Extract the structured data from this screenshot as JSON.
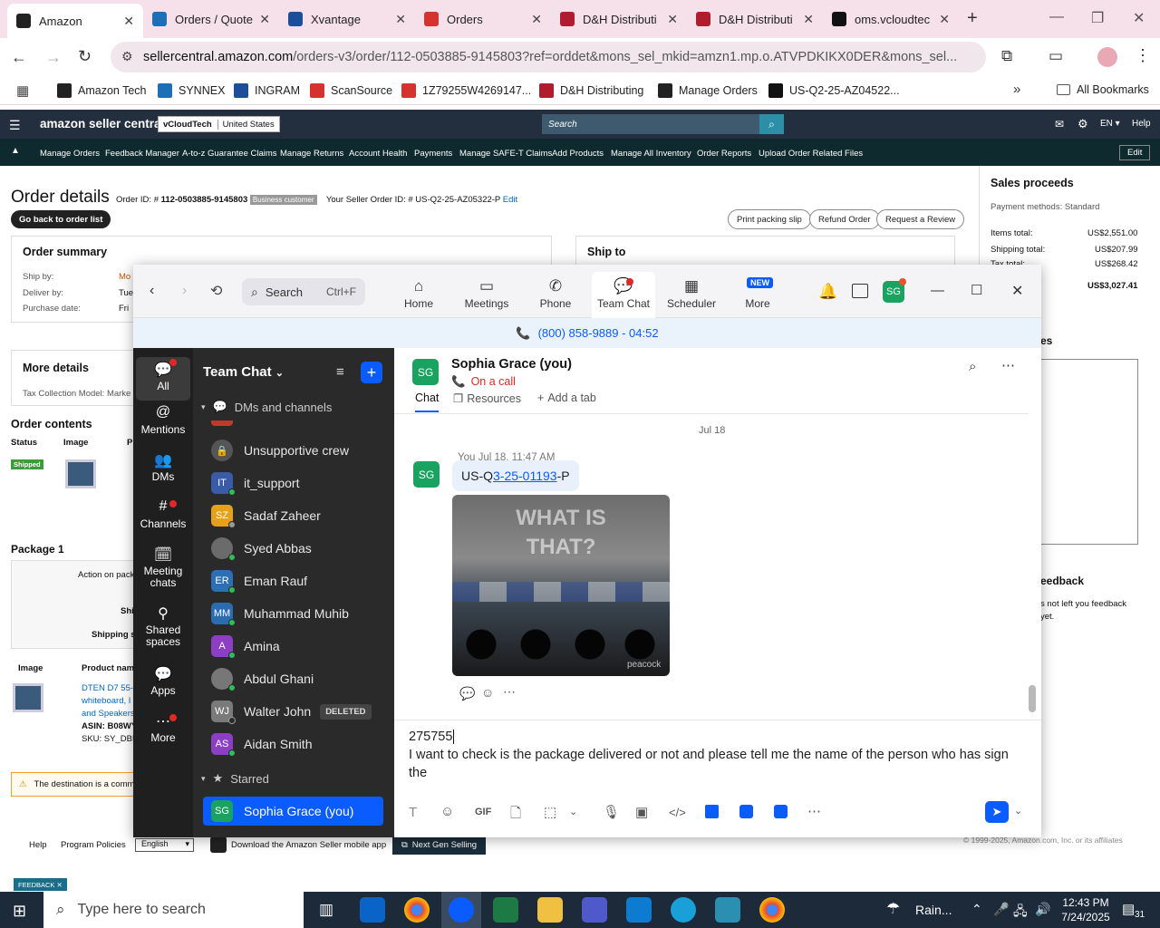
{
  "browser": {
    "tabs": [
      {
        "title": "Amazon",
        "color": "#222"
      },
      {
        "title": "Orders / Quote",
        "color": "#1d6fb8"
      },
      {
        "title": "Xvantage",
        "color": "#1d4e9a"
      },
      {
        "title": "Orders",
        "color": "#d6332e"
      },
      {
        "title": "D&H Distributi",
        "color": "#b01b2e"
      },
      {
        "title": "D&H Distributi",
        "color": "#b01b2e"
      },
      {
        "title": "oms.vcloudtec",
        "color": "#111"
      }
    ],
    "url_host": "sellercentral.amazon.com",
    "url_path": "/orders-v3/order/112-0503885-9145803?ref=orddet&mons_sel_mkid=amzn1.mp.o.ATVPDKIKX0DER&mons_sel...",
    "bookmarks": [
      "Amazon Tech",
      "SYNNEX",
      "INGRAM",
      "ScanSource",
      "1Z79255W4269147...",
      "D&H Distributing",
      "Manage Orders",
      "US-Q2-25-AZ04522..."
    ],
    "all_bookmarks": "All Bookmarks"
  },
  "amazon": {
    "logo": "amazon seller central",
    "store": "vCloudTech",
    "country": "United States",
    "search_placeholder": "Search",
    "lang": "EN",
    "help": "Help",
    "nav": [
      "Manage Orders",
      "Feedback Manager",
      "A-to-z Guarantee Claims",
      "Manage Returns",
      "Account Health",
      "Payments",
      "Manage SAFE-T Claims",
      "Add Products",
      "Manage All Inventory",
      "Order Reports",
      "Upload Order Related Files"
    ],
    "edit": "Edit",
    "order_title": "Order details",
    "order_id_label": "Order ID: #",
    "order_id": "112-0503885-9145803",
    "business": "Business customer",
    "seller_order_label": "Your Seller Order ID: #",
    "seller_order": "US-Q2-25-AZ05322-P",
    "seller_edit": "Edit",
    "back_btn": "Go back to order list",
    "btn_packing": "Print packing slip",
    "btn_refund": "Refund Order",
    "btn_review": "Request a Review",
    "order_summary": "Order summary",
    "ship_by": "Ship by:",
    "ship_by_val": "Mo",
    "deliver_by": "Deliver by:",
    "deliver_by_val": "Tue",
    "purchase_date": "Purchase date:",
    "purchase_date_val": "Fri",
    "ship_to": "Ship to",
    "more_details": "More details",
    "tax_model": "Tax Collection Model:",
    "tax_model_val": "Marke",
    "order_contents": "Order contents",
    "col_status": "Status",
    "col_image": "Image",
    "col_pr": "Pr",
    "shipped": "Shipped",
    "package": "Package 1",
    "action_on": "Action on pack",
    "shi": "Shi",
    "shipping_s": "Shipping s",
    "col_image2": "Image",
    "col_product": "Product nam",
    "product_lines": [
      "DTEN D7 55-",
      "whiteboard, I",
      "and Speakers"
    ],
    "asin": "ASIN: B08WY",
    "sku": "SKU: SY_DB5",
    "warning": "The destination is a comm",
    "sales_title": "Sales proceeds",
    "payment_methods": "Payment methods: Standard",
    "items_total": "Items total:",
    "items_total_val": "US$2,551.00",
    "shipping_total": "Shipping total:",
    "shipping_total_val": "US$207.99",
    "tax_total": "Tax total:",
    "tax_total_val": "US$268.42",
    "grand_total_val": "US$3,027.41",
    "es": "es",
    "feedback_title": "eedback",
    "feedback_text1": "s not left you feedback",
    "feedback_text2": "yet.",
    "footer_help": "Help",
    "footer_policies": "Program Policies",
    "footer_lang": "English",
    "footer_app": "Download the Amazon Seller mobile app",
    "footer_ngs": "Next Gen Selling",
    "copyright": "© 1999-2025, Amazon.com, Inc. or its affiliates",
    "feedback_tab": "FEEDBACK"
  },
  "zoom": {
    "search": "Search",
    "search_shortcut": "Ctrl+F",
    "nav": [
      {
        "label": "Home"
      },
      {
        "label": "Meetings"
      },
      {
        "label": "Phone"
      },
      {
        "label": "Team Chat"
      },
      {
        "label": "Scheduler"
      },
      {
        "label": "More"
      }
    ],
    "new_badge": "NEW",
    "avatar": "SG",
    "call_bar": "(800) 858-9889 - 04:52",
    "rail": [
      "All",
      "Mentions",
      "DMs",
      "Channels",
      "Meeting chats",
      "Shared spaces",
      "Apps",
      "More"
    ],
    "sidebar_title": "Team Chat",
    "section": "DMs and channels",
    "contacts": [
      {
        "name": "Unsupportive crew",
        "initials": "",
        "color": "#555",
        "status": "none"
      },
      {
        "name": "it_support",
        "initials": "IT",
        "color": "#3a5ba8",
        "status": "online"
      },
      {
        "name": "Sadaf Zaheer",
        "initials": "SZ",
        "color": "#e6a11a",
        "status": "away"
      },
      {
        "name": "Syed Abbas",
        "initials": "",
        "color": "#6b6b6b",
        "status": "online"
      },
      {
        "name": "Eman Rauf",
        "initials": "ER",
        "color": "#2c6fb5",
        "status": "online"
      },
      {
        "name": "Muhammad Muhib",
        "initials": "MM",
        "color": "#2b6cb0",
        "status": "online"
      },
      {
        "name": "Amina",
        "initials": "A",
        "color": "#8d3fc4",
        "status": "online"
      },
      {
        "name": "Abdul Ghani",
        "initials": "",
        "color": "#777",
        "status": "online"
      },
      {
        "name": "Walter John",
        "initials": "WJ",
        "color": "#7a7a7a",
        "status": "offline",
        "badge": "DELETED"
      },
      {
        "name": "Aidan Smith",
        "initials": "AS",
        "color": "#8d3fc4",
        "status": "online"
      }
    ],
    "starred": "Starred",
    "active_contact": "Sophia Grace (you)",
    "chat_name": "Sophia Grace (you)",
    "chat_status": "On a call",
    "tab_chat": "Chat",
    "tab_resources": "Resources",
    "tab_add": "Add a tab",
    "date_sep": "Jul 18",
    "msg_meta": "You Jul 18, 11:47 AM",
    "msg_prefix": "US-Q",
    "msg_link": "3-25-01193",
    "msg_suffix": "-P",
    "gif_text": "WHAT IS THAT?",
    "gif_brand": "peacock",
    "compose_line1": "275755",
    "compose_line2": "I want to check is the package delivered or not and please tell me the name of the person who has sign the",
    "gif_tool": "GIF"
  },
  "taskbar": {
    "search_placeholder": "Type here to search",
    "weather": "Rain...",
    "time": "12:43 PM",
    "date": "7/24/2025",
    "notif": "31"
  }
}
